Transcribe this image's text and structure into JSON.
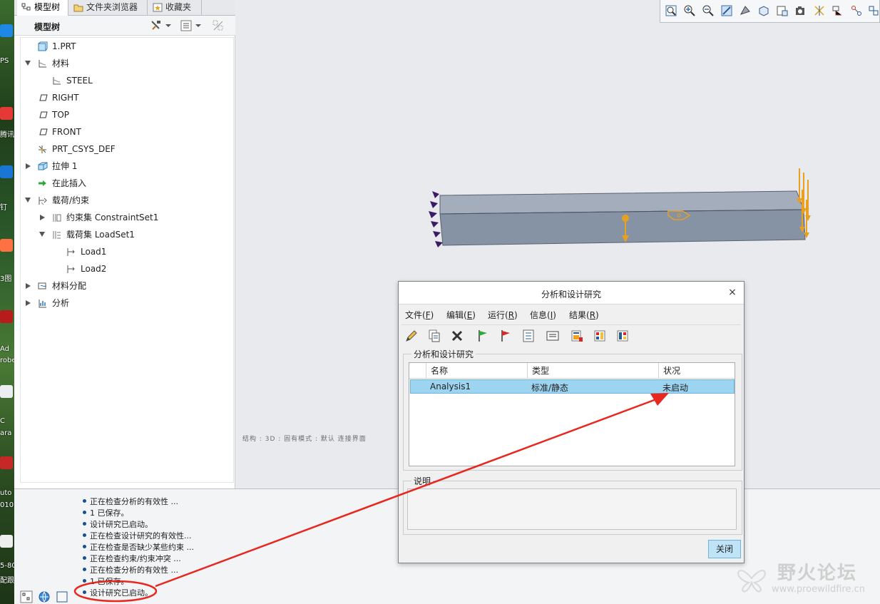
{
  "desktop": {
    "labels": [
      "PS",
      "腾讯",
      "钉",
      "3图",
      "Ad",
      "robe",
      "C",
      "ara",
      "uto",
      "010",
      "5-80",
      "配跟"
    ]
  },
  "left_panel": {
    "tabs": [
      {
        "label": "模型树",
        "active": true
      },
      {
        "label": "文件夹浏览器",
        "active": false
      },
      {
        "label": "收藏夹",
        "active": false
      }
    ],
    "header_title": "模型树",
    "tree": [
      {
        "label": "1.PRT",
        "level": 0,
        "toggle": "none",
        "icon": "part-icon"
      },
      {
        "label": "材料",
        "level": 0,
        "toggle": "expanded",
        "icon": "material-icon"
      },
      {
        "label": "STEEL",
        "level": 1,
        "toggle": "none",
        "icon": "material-icon"
      },
      {
        "label": "RIGHT",
        "level": 0,
        "toggle": "none",
        "icon": "datum-plane-icon"
      },
      {
        "label": "TOP",
        "level": 0,
        "toggle": "none",
        "icon": "datum-plane-icon"
      },
      {
        "label": "FRONT",
        "level": 0,
        "toggle": "none",
        "icon": "datum-plane-icon"
      },
      {
        "label": "PRT_CSYS_DEF",
        "level": 0,
        "toggle": "none",
        "icon": "csys-icon"
      },
      {
        "label": "拉伸 1",
        "level": 0,
        "toggle": "collapsed",
        "icon": "extrude-icon"
      },
      {
        "label": "在此插入",
        "level": 0,
        "toggle": "none",
        "icon": "insert-here-icon"
      },
      {
        "label": "载荷/约束",
        "level": 0,
        "toggle": "expanded",
        "icon": "loads-icon"
      },
      {
        "label": "约束集 ConstraintSet1",
        "level": 1,
        "toggle": "collapsed",
        "icon": "constraint-set-icon"
      },
      {
        "label": "载荷集 LoadSet1",
        "level": 1,
        "toggle": "expanded",
        "icon": "load-set-icon"
      },
      {
        "label": "Load1",
        "level": 2,
        "toggle": "none",
        "icon": "load-icon"
      },
      {
        "label": "Load2",
        "level": 2,
        "toggle": "none",
        "icon": "load-icon"
      },
      {
        "label": "材料分配",
        "level": 0,
        "toggle": "collapsed",
        "icon": "material-assign-icon"
      },
      {
        "label": "分析",
        "level": 0,
        "toggle": "collapsed",
        "icon": "analysis-icon"
      }
    ]
  },
  "graphics": {
    "status_text": "结构 : 3D : 固有模式 : 默认 连接界面"
  },
  "messages": [
    "正在检查分析的有效性 ...",
    "1 已保存。",
    "设计研究已启动。",
    "正在检查设计研究的有效性...",
    "正在检查是否缺少某些约束 ...",
    "正在检查约束/约束冲突 ...",
    "正在检查分析的有效性 ...",
    "1 已保存。",
    "设计研究已启动。"
  ],
  "dialog": {
    "title": "分析和设计研究",
    "menus": [
      {
        "label": "文件",
        "key": "F"
      },
      {
        "label": "编辑",
        "key": "E"
      },
      {
        "label": "运行",
        "key": "R"
      },
      {
        "label": "信息",
        "key": "I"
      },
      {
        "label": "结果",
        "key": "R"
      }
    ],
    "group_label": "分析和设计研究",
    "columns": [
      "名称",
      "类型",
      "状况"
    ],
    "rows": [
      {
        "name": "Analysis1",
        "type": "标准/静态",
        "status": "未启动"
      }
    ],
    "description_label": "说明",
    "close_label": "关闭"
  },
  "watermark": {
    "title": "野火论坛",
    "url": "www.proewildfire.cn"
  },
  "colors": {
    "annotation_red": "#e8281e",
    "selection_blue": "#9dd5f1",
    "load_orange": "#e8a020",
    "constraint_purple": "#3b1a66"
  }
}
